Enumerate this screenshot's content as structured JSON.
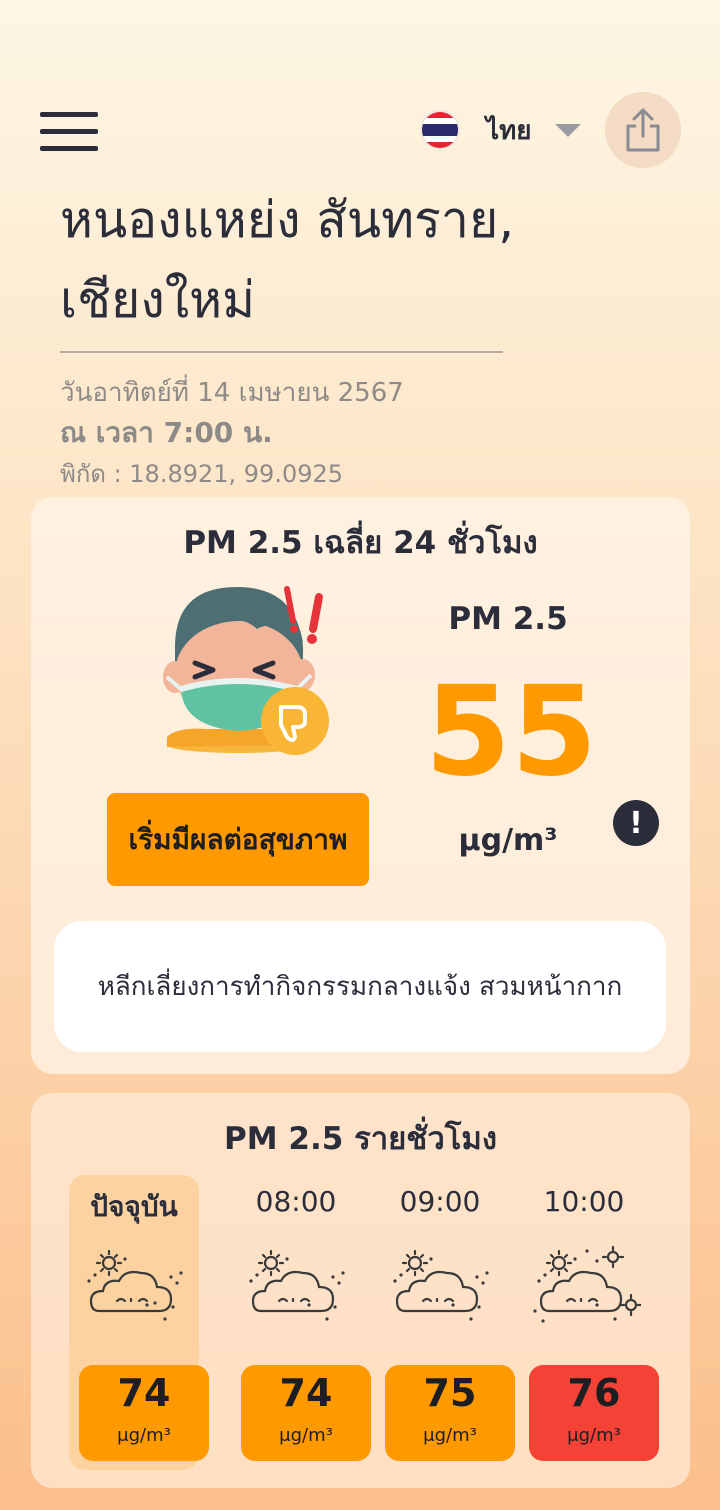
{
  "header": {
    "language_label": "ไทย",
    "language_flag": "thailand-flag"
  },
  "location": {
    "name": "หนองแหย่ง สันทราย, เชียงใหม่",
    "date": "วันอาทิตย์ที่ 14 เมษายน 2567",
    "time": "ณ เวลา 7:00 น.",
    "coords": "พิกัด : 18.8921, 99.0925"
  },
  "daily": {
    "title": "PM 2.5 เฉลี่ย 24 ชั่วโมง",
    "pollutant": "PM 2.5",
    "value": "55",
    "unit": "μg/m³",
    "status_label": "เริ่มมีผลต่อสุขภาพ",
    "status_color": "#ff9900",
    "info_icon": "!",
    "advice": "หลีกเลี่ยงการทำกิจกรรมกลางแจ้ง สวมหน้ากาก"
  },
  "hourly": {
    "title": "PM 2.5 รายชั่วโมง",
    "items": [
      {
        "label": "ปัจจุบัน",
        "value": "74",
        "unit": "μg/m³",
        "color": "#ff9900",
        "icon": "cloud-sun-dust-icon",
        "current": true
      },
      {
        "label": "08:00",
        "value": "74",
        "unit": "μg/m³",
        "color": "#ff9900",
        "icon": "cloud-sun-dust-icon",
        "current": false
      },
      {
        "label": "09:00",
        "value": "75",
        "unit": "μg/m³",
        "color": "#ff9900",
        "icon": "cloud-sun-dust-icon",
        "current": false
      },
      {
        "label": "10:00",
        "value": "76",
        "unit": "μg/m³",
        "color": "#f44336",
        "icon": "cloud-sun-dust-icon",
        "current": false
      }
    ]
  }
}
